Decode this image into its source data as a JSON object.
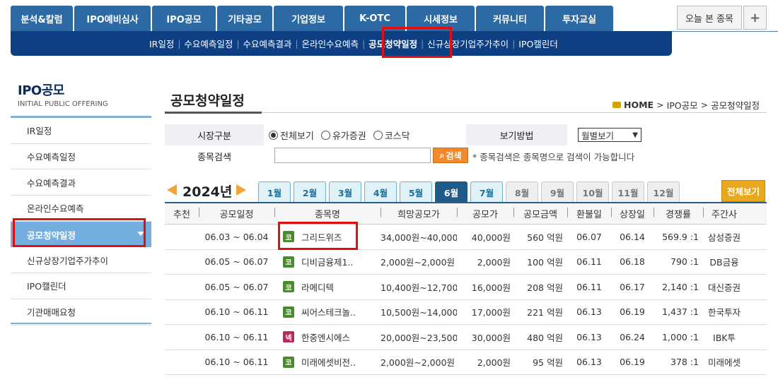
{
  "top_nav": {
    "tabs": [
      "분석&칼럼",
      "IPO예비심사",
      "IPO공모",
      "기타공모",
      "기업정보",
      "K-OTC",
      "시세정보",
      "커뮤니티",
      "투자교실"
    ],
    "today_label": "오늘 본 종목",
    "plus_label": "+"
  },
  "sub_nav": {
    "items": [
      "IR일정",
      "수요예측일정",
      "수요예측결과",
      "온라인수요예측",
      "공모청약일정",
      "신규상장기업주가추이",
      "IPO캘린더"
    ],
    "active_index": 4
  },
  "sidebar": {
    "title": "IPO공모",
    "subtitle": "INITIAL PUBLIC OFFERING",
    "items": [
      "IR일정",
      "수요예측일정",
      "수요예측결과",
      "온라인수요예측",
      "공모청약일정",
      "신규상장기업주가추이",
      "IPO캘린더",
      "기관매매요청"
    ],
    "active_index": 4
  },
  "page": {
    "title": "공모청약일정",
    "breadcrumb": [
      "HOME",
      "IPO공모",
      "공모청약일정"
    ]
  },
  "filter": {
    "market_label": "시장구분",
    "market_options": [
      "전체보기",
      "유가증권",
      "코스닥"
    ],
    "market_selected": "전체보기",
    "view_label": "보기방법",
    "view_value": "월별보기",
    "search_label": "종목검색",
    "search_value": "",
    "search_button": "검색",
    "search_note": "* 종목검색은 종목명으로 검색이 가능합니다"
  },
  "calendar": {
    "year": "2024년",
    "months": [
      "1월",
      "2월",
      "3월",
      "4월",
      "5월",
      "6월",
      "7월",
      "8월",
      "9월",
      "10월",
      "11월",
      "12월"
    ],
    "active_month": "6월",
    "all_label": "전체보기"
  },
  "table": {
    "headers": [
      "추천",
      "공모일정",
      "종목명",
      "희망공모가",
      "공모가",
      "공모금액",
      "환불일",
      "상장일",
      "경쟁률",
      "주간사"
    ],
    "rows": [
      {
        "rec": "",
        "schedule": "06.03 ~ 06.04",
        "market": "코",
        "name": "그리드위즈",
        "hope": "34,000원~40,000원",
        "price": "40,000원",
        "amount": "560 억원",
        "refund": "06.07",
        "listing": "06.14",
        "ratio": "569.9 :1",
        "underwriter": "삼성증권"
      },
      {
        "rec": "",
        "schedule": "06.05 ~ 06.07",
        "market": "코",
        "name": "디비금융제1..",
        "hope": "2,000원~2,000원",
        "price": "2,000원",
        "amount": "100 억원",
        "refund": "06.11",
        "listing": "06.18",
        "ratio": "790 :1",
        "underwriter": "DB금융"
      },
      {
        "rec": "",
        "schedule": "06.05 ~ 06.07",
        "market": "코",
        "name": "라메디텍",
        "hope": "10,400원~12,700원",
        "price": "16,000원",
        "amount": "208 억원",
        "refund": "06.11",
        "listing": "06.17",
        "ratio": "2,140 :1",
        "underwriter": "대신증권"
      },
      {
        "rec": "",
        "schedule": "06.10 ~ 06.11",
        "market": "코",
        "name": "씨어스테크놀..",
        "hope": "10,500원~14,000원",
        "price": "17,000원",
        "amount": "221 억원",
        "refund": "06.13",
        "listing": "06.19",
        "ratio": "1,437 :1",
        "underwriter": "한국투자"
      },
      {
        "rec": "",
        "schedule": "06.10 ~ 06.11",
        "market": "넥",
        "name": "한중엔시에스",
        "hope": "20,000원~23,500원",
        "price": "30,000원",
        "amount": "480 억원",
        "refund": "06.13",
        "listing": "06.24",
        "ratio": "1,000 :1",
        "underwriter": "IBK투"
      },
      {
        "rec": "",
        "schedule": "06.10 ~ 06.11",
        "market": "코",
        "name": "미래에셋비전..",
        "hope": "2,000원~2,000원",
        "price": "2,000원",
        "amount": "95 억원",
        "refund": "06.13",
        "listing": "06.19",
        "ratio": "378 :1",
        "underwriter": "미래에셋"
      }
    ]
  },
  "colors": {
    "nav_tab": "#2c6aa5",
    "sub_bar": "#0d3f82",
    "sidebar_active": "#74aedf",
    "highlight_box": "#e01010",
    "kosdaq_badge": "#4a8b2e",
    "konex_badge": "#b32d5a"
  }
}
